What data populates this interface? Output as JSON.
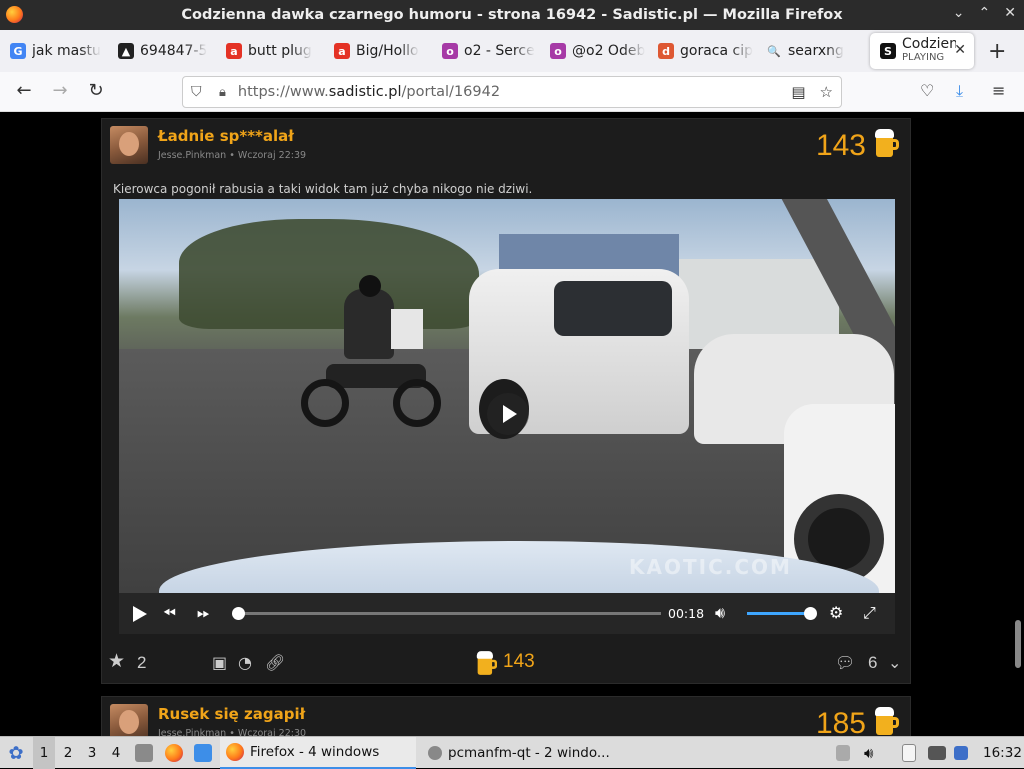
{
  "window": {
    "title": "Codzienna dawka czarnego humoru - strona 16942 - Sadistic.pl — Mozilla Firefox",
    "controls": [
      "⌄",
      "⌃",
      "✕"
    ]
  },
  "tabs": [
    {
      "label": "jak mastu",
      "favicon": "google-icon",
      "fav_text": "G",
      "fav_color": "#4285f4"
    },
    {
      "label": "694847-5",
      "favicon": "mountain-icon",
      "fav_text": "▲",
      "fav_color": "#222"
    },
    {
      "label": "butt plug",
      "favicon": "aliexpress-icon",
      "fav_text": "a",
      "fav_color": "#e43225"
    },
    {
      "label": "Big/Hollo",
      "favicon": "aliexpress-icon",
      "fav_text": "a",
      "fav_color": "#e43225"
    },
    {
      "label": "o2 - Serce",
      "favicon": "o2-icon",
      "fav_text": "o",
      "fav_color": "#a63aa6"
    },
    {
      "label": "@o2 Odeb",
      "favicon": "o2-icon",
      "fav_text": "o",
      "fav_color": "#a63aa6"
    },
    {
      "label": "goraca cip",
      "favicon": "duckduckgo-icon",
      "fav_text": "d",
      "fav_color": "#de5833"
    },
    {
      "label": "searxng",
      "favicon": "search-icon",
      "fav_text": "🔍",
      "fav_color": "transparent"
    }
  ],
  "active_tab": {
    "label": "Codzienn",
    "sublabel": "PLAYING",
    "fav_text": "S",
    "fav_color": "#111",
    "close": "✕"
  },
  "newtab": "+",
  "nav": {
    "back": "←",
    "forward": "→",
    "reload": "↻",
    "url_prefix": "https://www.",
    "url_domain": "sadistic.pl",
    "url_path": "/portal/16942",
    "pocket": "♡",
    "downloads": "⤓",
    "menu": "≡",
    "reader": "▤",
    "star": "☆"
  },
  "post1": {
    "title": "Ładnie sp***alał",
    "author": "Jesse.Pinkman",
    "time": "Wczoraj 22:39",
    "score": "143",
    "description": "Kierowca pogonił rabusia a taki widok tam już chyba nikogo nie dziwi.",
    "video": {
      "time": "00:18",
      "progress": 0.0,
      "volume": 1.0,
      "watermark": "KAOTIC.COM"
    },
    "footer": {
      "stars": "2",
      "beer_score": "143",
      "comments": "6"
    }
  },
  "post2": {
    "title": "Rusek się zagapił",
    "author": "Jesse.Pinkman",
    "time": "Wczoraj 22:30",
    "score": "185"
  },
  "colors": {
    "accent": "#f0a419",
    "post_bg": "#1c1c1c"
  },
  "taskbar": {
    "workspaces": [
      "1",
      "2",
      "3",
      "4"
    ],
    "tasks": [
      {
        "label": "Firefox - 4 windows"
      },
      {
        "label": "pcmanfm-qt - 2 windo..."
      }
    ],
    "clock": "16:32"
  }
}
